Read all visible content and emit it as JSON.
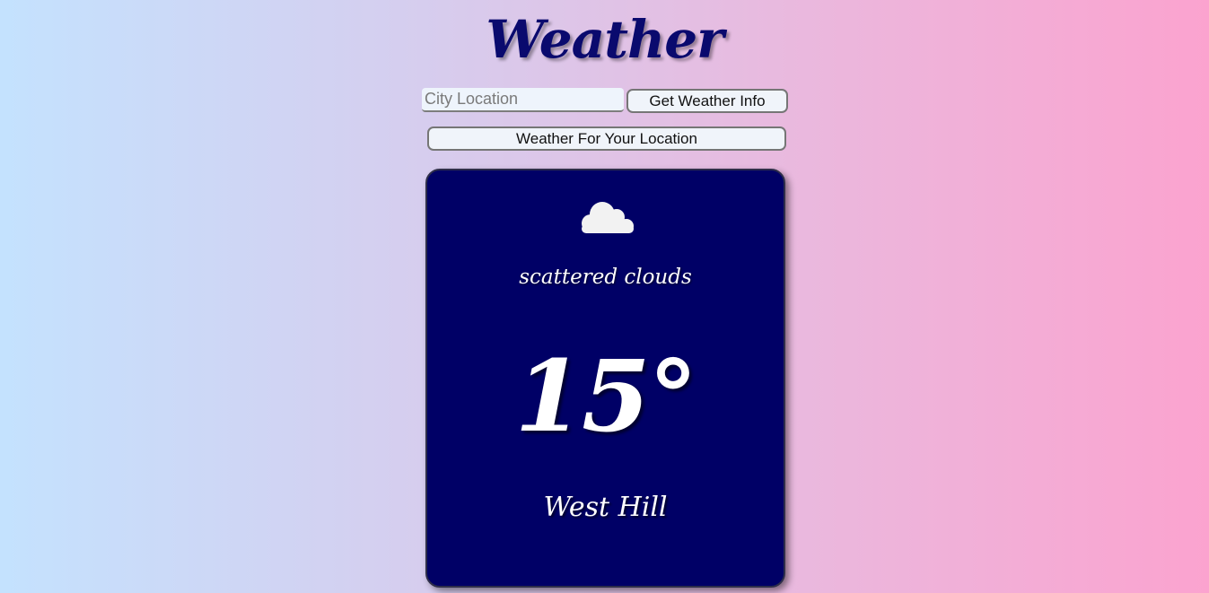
{
  "header": {
    "title": "Weather"
  },
  "search": {
    "placeholder": "City Location",
    "value": "",
    "submit_label": "Get Weather Info"
  },
  "geo": {
    "button_label": "Weather For Your Location"
  },
  "weather_card": {
    "icon": "cloud-icon",
    "description": "scattered clouds",
    "temperature": "15°",
    "location": "West Hill",
    "background_color": "#000066",
    "text_color": "#ffffff"
  },
  "theme": {
    "title_color": "#0a0a6e",
    "gradient_left": "#c4e2fe",
    "gradient_right": "#fba3cf"
  }
}
